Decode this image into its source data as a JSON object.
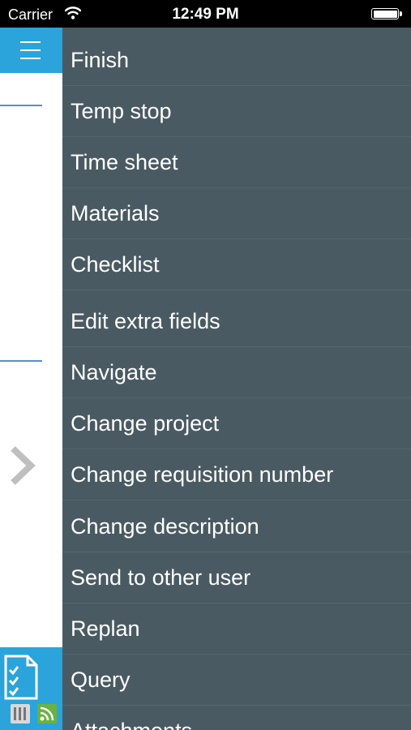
{
  "status_bar": {
    "carrier": "Carrier",
    "time": "12:49 PM"
  },
  "drawer": {
    "items": [
      {
        "label": "Finish"
      },
      {
        "label": "Temp stop"
      },
      {
        "label": "Time sheet"
      },
      {
        "label": "Materials"
      },
      {
        "label": "Checklist"
      },
      {
        "label": "Edit extra fields"
      },
      {
        "label": "Navigate"
      },
      {
        "label": "Change project"
      },
      {
        "label": "Change requisition number"
      },
      {
        "label": "Change description"
      },
      {
        "label": "Send to other user"
      },
      {
        "label": "Replan"
      },
      {
        "label": "Query"
      },
      {
        "label": "Attachments"
      }
    ]
  },
  "colors": {
    "accent": "#2aa4da",
    "drawer_bg": "#4a5a62",
    "divider": "#5a8fc0",
    "rss_green": "#6ab23f"
  },
  "icons": {
    "menu": "hamburger-menu-icon",
    "chevron": "chevron-right-icon",
    "document": "checklist-document-icon",
    "barcode": "barcode-icon",
    "feed": "rss-feed-icon",
    "wifi": "wifi-icon",
    "battery": "battery-icon"
  }
}
